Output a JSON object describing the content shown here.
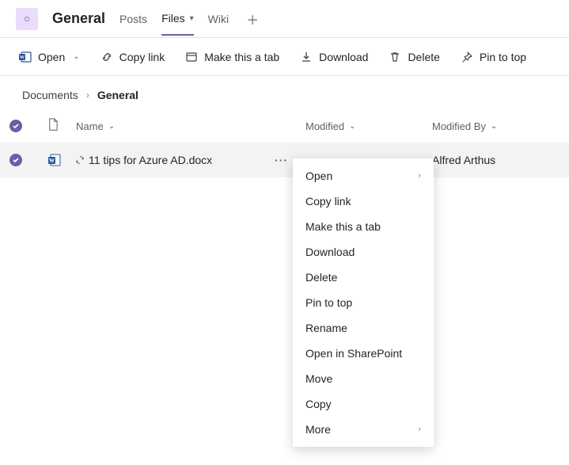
{
  "header": {
    "channel": "General",
    "tabs": [
      "Posts",
      "Files",
      "Wiki"
    ],
    "active_tab": "Files"
  },
  "toolbar": {
    "open": "Open",
    "copy_link": "Copy link",
    "make_tab": "Make this a tab",
    "download": "Download",
    "delete": "Delete",
    "pin": "Pin to top"
  },
  "breadcrumb": {
    "root": "Documents",
    "current": "General"
  },
  "columns": {
    "name": "Name",
    "modified": "Modified",
    "modified_by": "Modified By"
  },
  "row": {
    "filename": "11 tips for Azure AD.docx",
    "modified_by": "Alfred Arthus"
  },
  "context_menu": {
    "open": "Open",
    "copy_link": "Copy link",
    "make_tab": "Make this a tab",
    "download": "Download",
    "delete": "Delete",
    "pin": "Pin to top",
    "rename": "Rename",
    "open_sp": "Open in SharePoint",
    "move": "Move",
    "copy": "Copy",
    "more": "More"
  }
}
